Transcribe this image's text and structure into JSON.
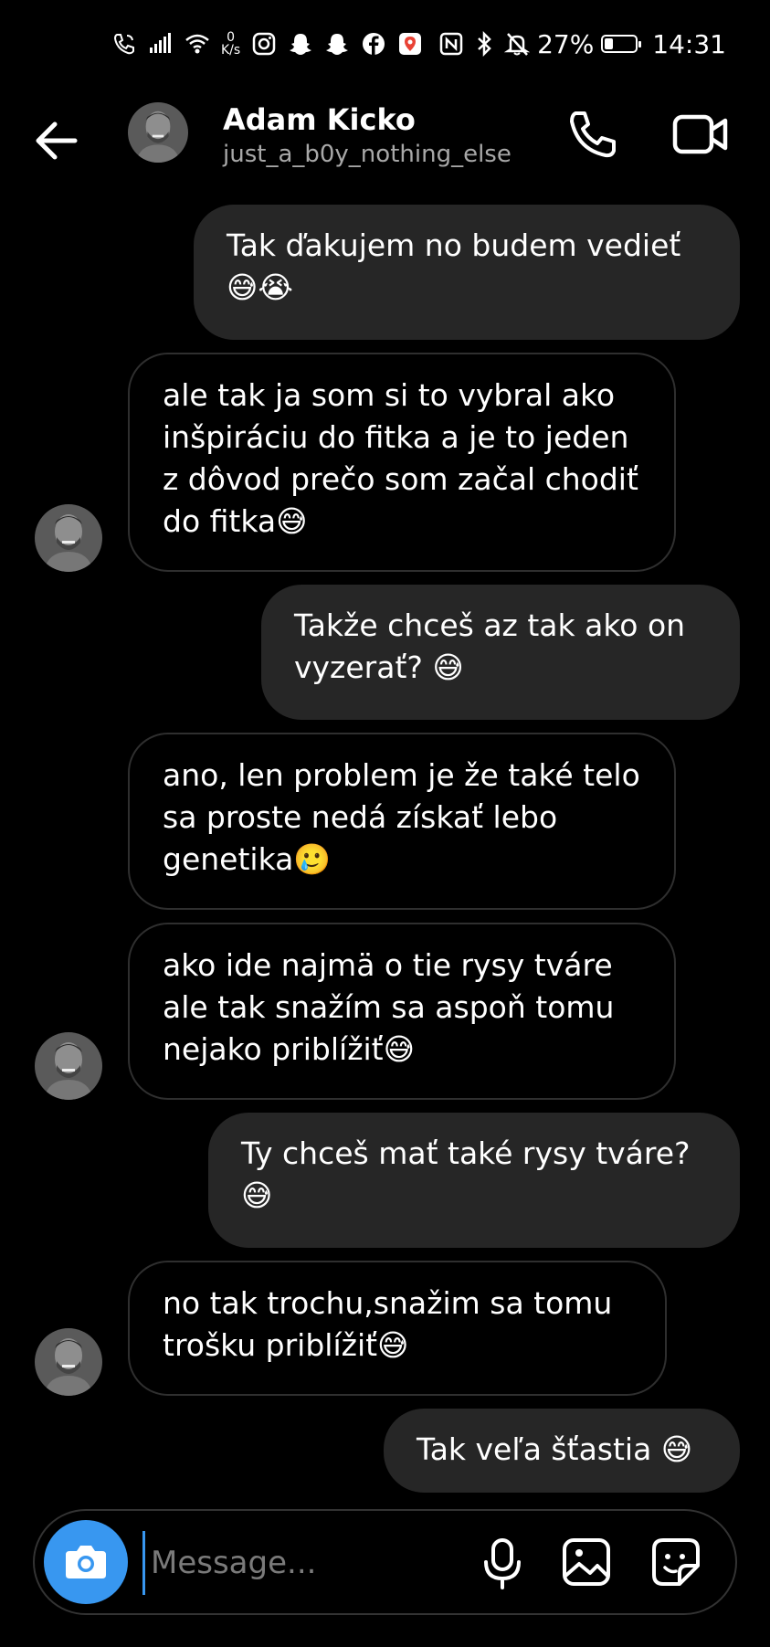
{
  "status_bar": {
    "net_speed_value": "0",
    "net_speed_unit": "K/s",
    "battery_percent": "27%",
    "battery_level": 0.27,
    "time": "14:31"
  },
  "header": {
    "name": "Adam Kicko",
    "username": "just_a_b0y_nothing_else"
  },
  "messages": [
    {
      "direction": "out",
      "text": "Tak ďakujem no budem vedieť 😅😭"
    },
    {
      "direction": "in",
      "text": "ale tak ja som si to vybral ako inšpiráciu do fitka a je to jeden z dôvod prečo som začal chodiť do fitka😅"
    },
    {
      "direction": "out",
      "text": "Takže chceš az tak ako on vyzerať? 😅"
    },
    {
      "direction": "in",
      "text": "ano, len problem je že také telo sa proste nedá získať lebo genetika🥲"
    },
    {
      "direction": "in",
      "text": "ako ide najmä o tie rysy tváre ale tak snažím sa aspoň tomu nejako priblížiť😅"
    },
    {
      "direction": "out",
      "text": "Ty chceš mať také rysy tváre? 😅"
    },
    {
      "direction": "in",
      "text": "no tak trochu,snažim sa tomu trošku priblížiť😅"
    },
    {
      "direction": "out",
      "text": "Tak veľa šťastia 😅"
    }
  ],
  "composer": {
    "placeholder": "Message..."
  },
  "icons": {
    "back": "arrow-left-icon",
    "call": "phone-icon",
    "video": "video-camera-icon",
    "camera": "camera-icon",
    "mic": "microphone-icon",
    "gallery": "image-icon",
    "sticker": "sticker-icon"
  },
  "colors": {
    "background": "#000000",
    "outgoing_bubble": "#262626",
    "incoming_border": "#2f2f2f",
    "accent": "#3897f0",
    "secondary_text": "#a8a8a8"
  }
}
